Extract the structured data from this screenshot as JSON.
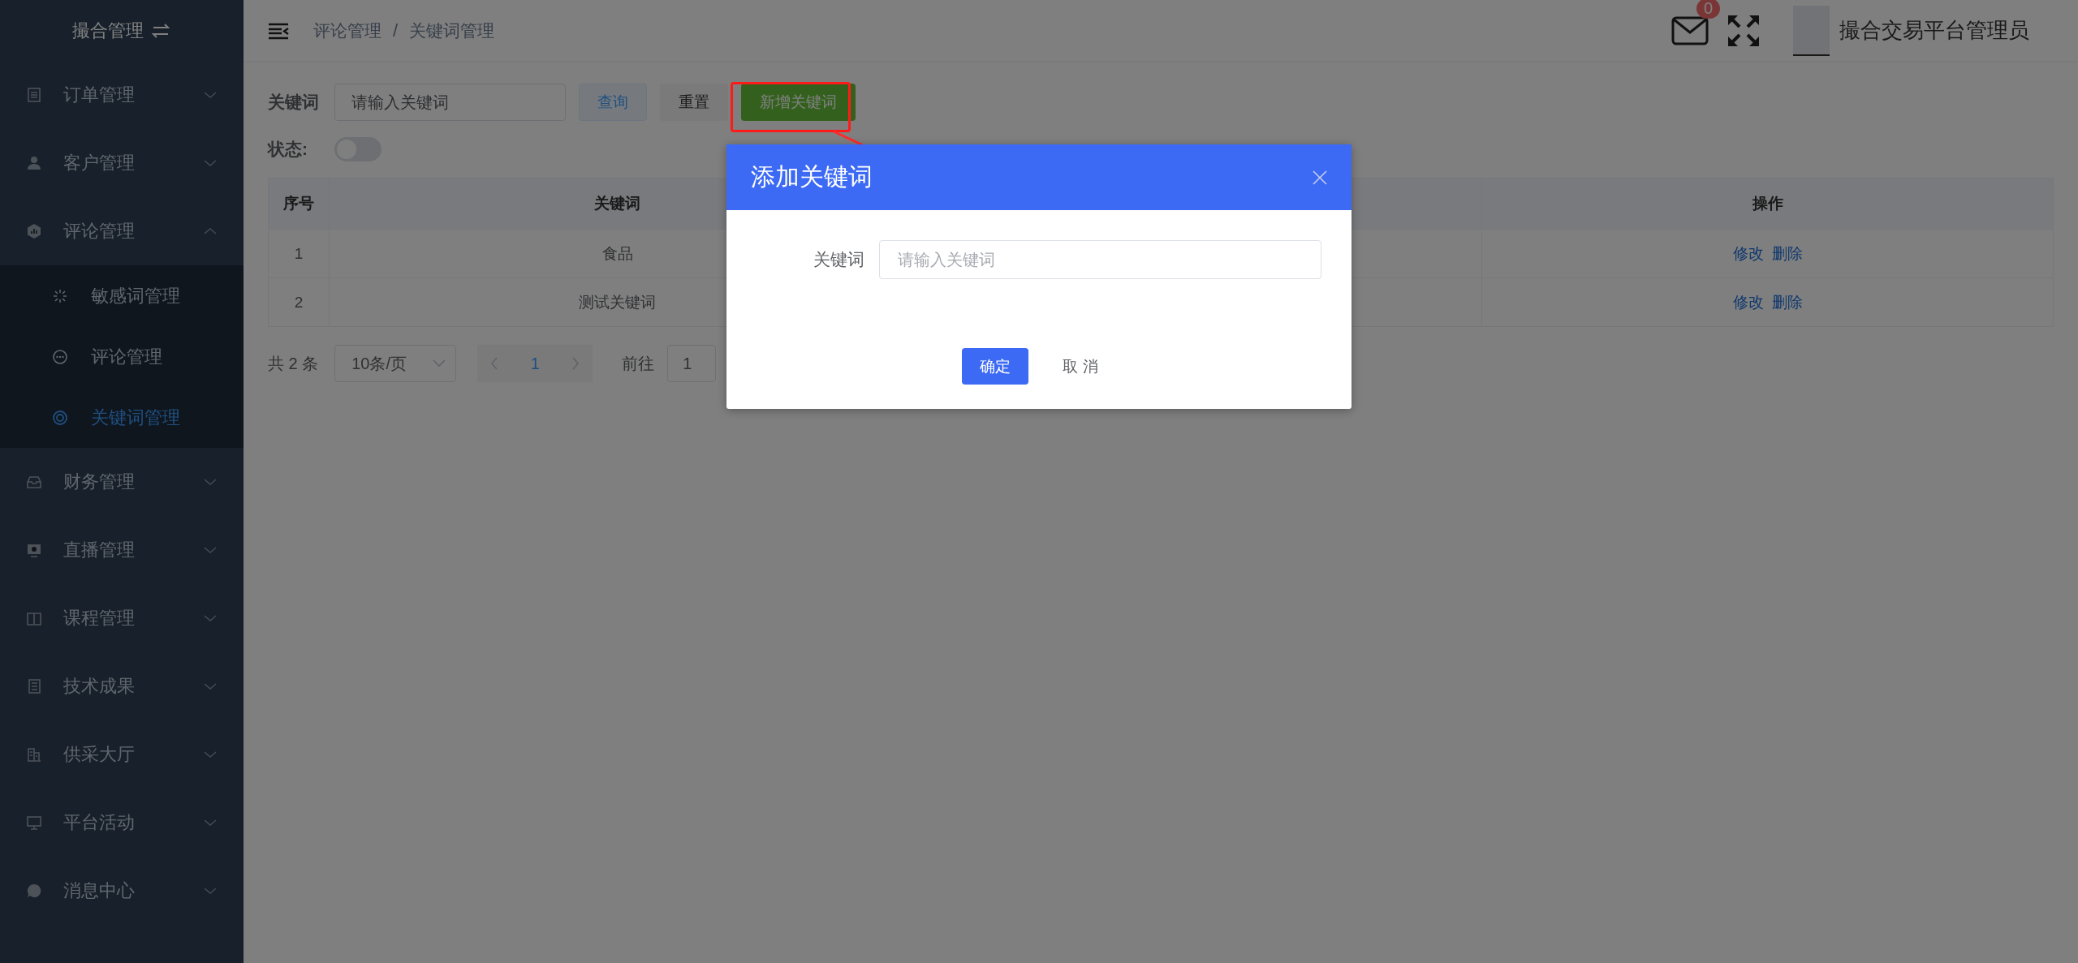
{
  "sidebar": {
    "title": "撮合管理",
    "items": [
      {
        "label": "订单管理",
        "expanded": false
      },
      {
        "label": "客户管理",
        "expanded": false
      },
      {
        "label": "评论管理",
        "expanded": true,
        "children": [
          {
            "label": "敏感词管理",
            "selected": false
          },
          {
            "label": "评论管理",
            "selected": false
          },
          {
            "label": "关键词管理",
            "selected": true
          }
        ]
      },
      {
        "label": "财务管理",
        "expanded": false
      },
      {
        "label": "直播管理",
        "expanded": false
      },
      {
        "label": "课程管理",
        "expanded": false
      },
      {
        "label": "技术成果",
        "expanded": false
      },
      {
        "label": "供采大厅",
        "expanded": false
      },
      {
        "label": "平台活动",
        "expanded": false
      },
      {
        "label": "消息中心",
        "expanded": false
      }
    ]
  },
  "header": {
    "breadcrumbs": [
      "评论管理",
      "关键词管理"
    ],
    "breadcrumb_separator": "/",
    "mail_badge": "0",
    "user_name": "撮合交易平台管理员"
  },
  "filters": {
    "keyword_label": "关键词",
    "keyword_placeholder": "请输入关键词",
    "search_button": "查询",
    "reset_button": "重置",
    "add_button": "新增关键词",
    "status_label": "状态:",
    "status_on": false
  },
  "table": {
    "columns": [
      "序号",
      "关键词",
      "操作"
    ],
    "rows": [
      {
        "index": "1",
        "keyword": "食品",
        "actions": [
          "修改",
          "删除"
        ]
      },
      {
        "index": "2",
        "keyword": "测试关键词",
        "actions": [
          "修改",
          "删除"
        ]
      }
    ]
  },
  "pagination": {
    "total": "共 2 条",
    "page_size": "10条/页",
    "pages": [
      {
        "label": "1",
        "selected": true
      }
    ],
    "goto_label": "前往",
    "goto_value": "1"
  },
  "dialog": {
    "title": "添加关键词",
    "field_label": "关键词",
    "field_placeholder": "请输入关键词",
    "confirm": "确定",
    "cancel": "取 消"
  }
}
